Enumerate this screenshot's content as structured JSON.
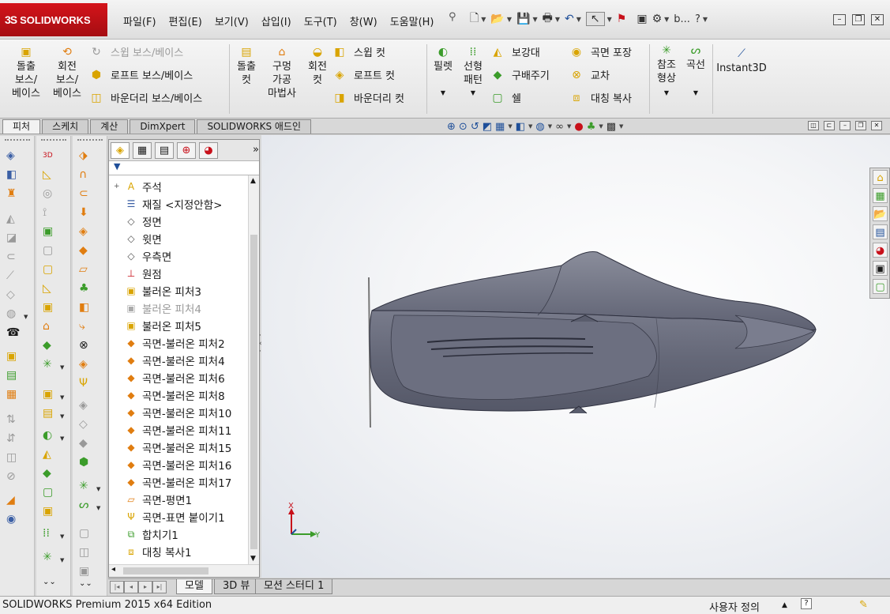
{
  "app": {
    "logo_mark": "3S",
    "logo_text": "SOLIDWORKS",
    "menu": [
      "파일(F)",
      "편집(E)",
      "보기(V)",
      "삽입(I)",
      "도구(T)",
      "창(W)",
      "도움말(H)"
    ],
    "user_abbrev": "b...",
    "help_glyph": "?"
  },
  "ribbon": {
    "extruded_boss": [
      "돌출",
      "보스/",
      "베이스"
    ],
    "revolved_boss": [
      "회전",
      "보스/",
      "베이스"
    ],
    "swept_boss": "스윕 보스/베이스",
    "lofted_boss": "로프트 보스/베이스",
    "boundary_boss": "바운더리 보스/베이스",
    "extruded_cut": [
      "돌출",
      "컷"
    ],
    "hole_wizard": [
      "구멍",
      "가공",
      "마법사"
    ],
    "revolved_cut": [
      "회전",
      "컷"
    ],
    "swept_cut": "스윕 컷",
    "lofted_cut": "로프트 컷",
    "boundary_cut": "바운더리 컷",
    "fillet": "필렛",
    "linear_pattern": [
      "선형",
      "패턴"
    ],
    "rib": "보강대",
    "draft": "구배주기",
    "shell": "쉘",
    "wrap": "곡면 포장",
    "intersect": "교차",
    "mirror": "대칭 복사",
    "ref_geometry": [
      "참조",
      "형상"
    ],
    "curves": "곡선",
    "instant3d": "Instant3D"
  },
  "tabs": [
    "피처",
    "스케치",
    "계산",
    "DimXpert",
    "SOLIDWORKS 애드인"
  ],
  "feature_tree": [
    {
      "label": "주석",
      "icon": "annotations-icon",
      "expand": "+"
    },
    {
      "label": "재질 <지정안함>",
      "icon": "material-icon",
      "expand": ""
    },
    {
      "label": "정면",
      "icon": "plane-icon",
      "expand": ""
    },
    {
      "label": "윗면",
      "icon": "plane-icon",
      "expand": ""
    },
    {
      "label": "우측면",
      "icon": "plane-icon",
      "expand": ""
    },
    {
      "label": "원점",
      "icon": "origin-icon",
      "expand": ""
    },
    {
      "label": "불러온 피처3",
      "icon": "imported-feature-icon",
      "expand": ""
    },
    {
      "label": "불러온 피처4",
      "icon": "imported-feature-icon",
      "expand": "",
      "suppressed": true
    },
    {
      "label": "불러온 피처5",
      "icon": "imported-feature-icon",
      "expand": ""
    },
    {
      "label": "곡면-불러온 피처2",
      "icon": "surface-icon",
      "expand": ""
    },
    {
      "label": "곡면-불러온 피처4",
      "icon": "surface-icon",
      "expand": ""
    },
    {
      "label": "곡면-불러온 피처6",
      "icon": "surface-icon",
      "expand": ""
    },
    {
      "label": "곡면-불러온 피처8",
      "icon": "surface-icon",
      "expand": ""
    },
    {
      "label": "곡면-불러온 피처10",
      "icon": "surface-icon",
      "expand": ""
    },
    {
      "label": "곡면-불러온 피처11",
      "icon": "surface-icon",
      "expand": ""
    },
    {
      "label": "곡면-불러온 피처15",
      "icon": "surface-icon",
      "expand": ""
    },
    {
      "label": "곡면-불러온 피처16",
      "icon": "surface-icon",
      "expand": ""
    },
    {
      "label": "곡면-불러온 피처17",
      "icon": "surface-icon",
      "expand": ""
    },
    {
      "label": "곡면-평면1",
      "icon": "planar-surface-icon",
      "expand": ""
    },
    {
      "label": "곡면-표면 붙이기1",
      "icon": "knit-surface-icon",
      "expand": ""
    },
    {
      "label": "합치기1",
      "icon": "combine-icon",
      "expand": ""
    },
    {
      "label": "대칭 복사1",
      "icon": "mirror-icon",
      "expand": ""
    }
  ],
  "triad": {
    "x": "X",
    "y": "Y"
  },
  "bottom_tabs": [
    "모델",
    "3D 뷰",
    "모션 스터디 1"
  ],
  "status": {
    "product": "SOLIDWORKS Premium 2015 x64 Edition",
    "units": "사용자 정의",
    "help": "?"
  },
  "colors": {
    "brand_red": "#c8101a",
    "part_body": "#6d7080",
    "accent_blue": "#1f4f99"
  }
}
